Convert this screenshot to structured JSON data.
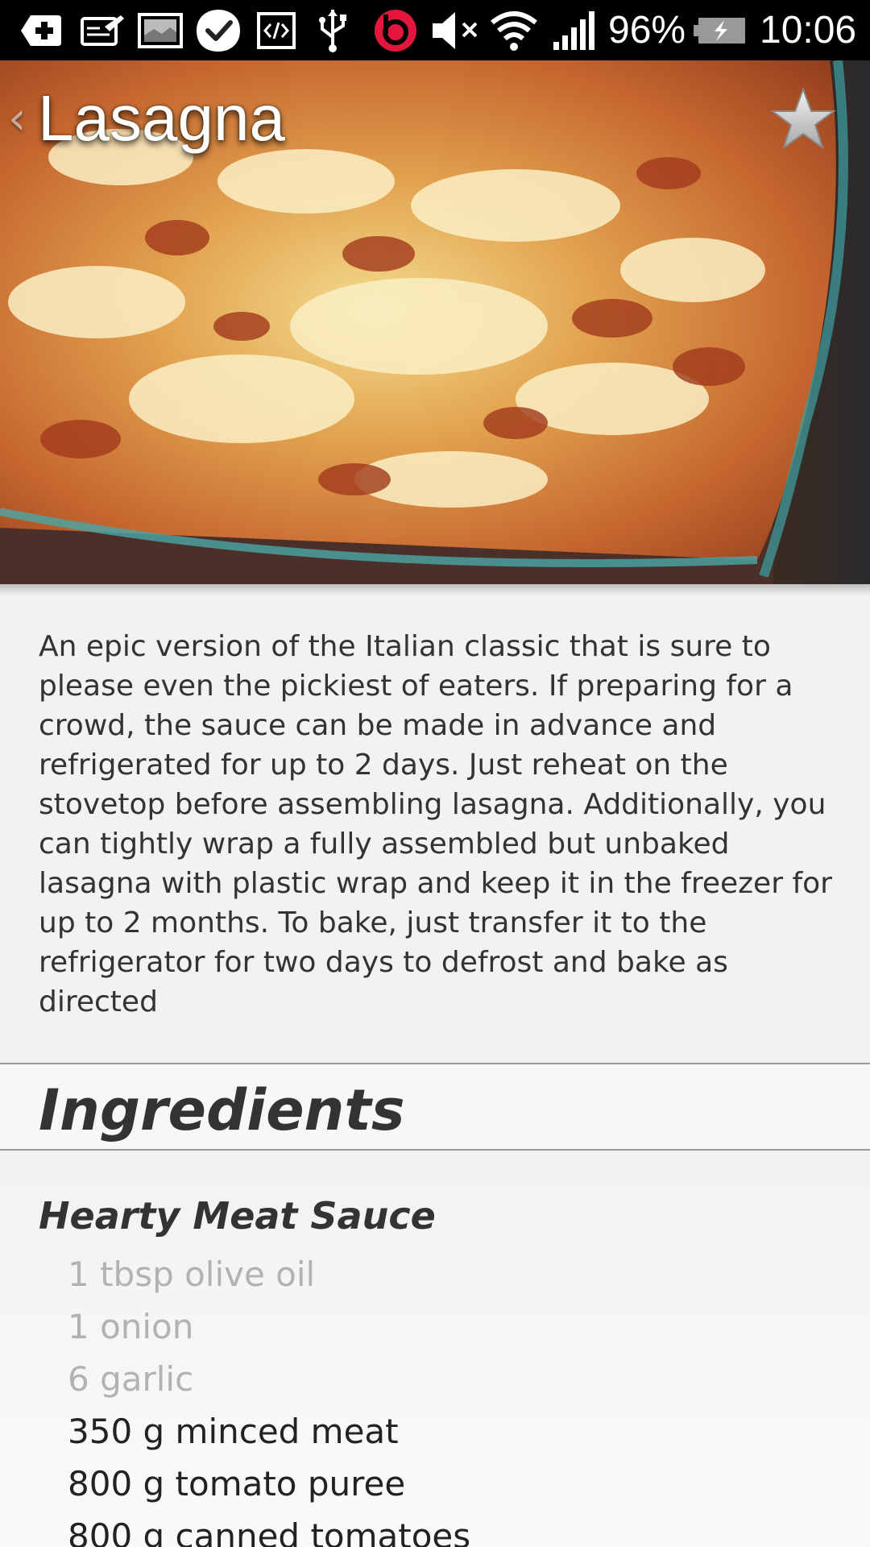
{
  "status_bar": {
    "icons": [
      "add-box-icon",
      "note-icon",
      "gallery-icon",
      "check-icon",
      "code-icon",
      "usb-icon",
      "beats-icon",
      "mute-icon",
      "wifi-icon",
      "signal-icon",
      "battery-charging-icon"
    ],
    "battery": "96%",
    "time": "10:06"
  },
  "header": {
    "back_glyph": "‹",
    "title": "Lasagna",
    "favorite_icon": "star-icon"
  },
  "description": "An epic version of the Italian classic that is sure to please even the pickiest of eaters. If preparing for a crowd, the sauce can be made in advance and refrigerated for up to 2 days. Just reheat on the stovetop before assembling lasagna. Additionally, you can tightly wrap a fully assembled but unbaked lasagna with plastic wrap and keep it in the freezer for up to 2 months. To bake, just transfer it to the refrigerator for two days to defrost and bake as directed",
  "ingredients": {
    "title": "Ingredients",
    "groups": [
      {
        "name": "Hearty Meat Sauce",
        "items": [
          {
            "text": "1 tbsp olive oil",
            "state": "dim"
          },
          {
            "text": "1 onion",
            "state": "dim"
          },
          {
            "text": "6 garlic",
            "state": "dim"
          },
          {
            "text": "350 g minced meat",
            "state": "dark"
          },
          {
            "text": "800 g tomato puree",
            "state": "dark"
          },
          {
            "text": "800 g canned tomatoes",
            "state": "dark"
          }
        ]
      }
    ]
  },
  "colors": {
    "background": "#f2f2f2",
    "status_bar": "#000000",
    "text_primary": "#333333",
    "text_checked": "#b2b2b2",
    "beats_red": "#e3173e"
  }
}
